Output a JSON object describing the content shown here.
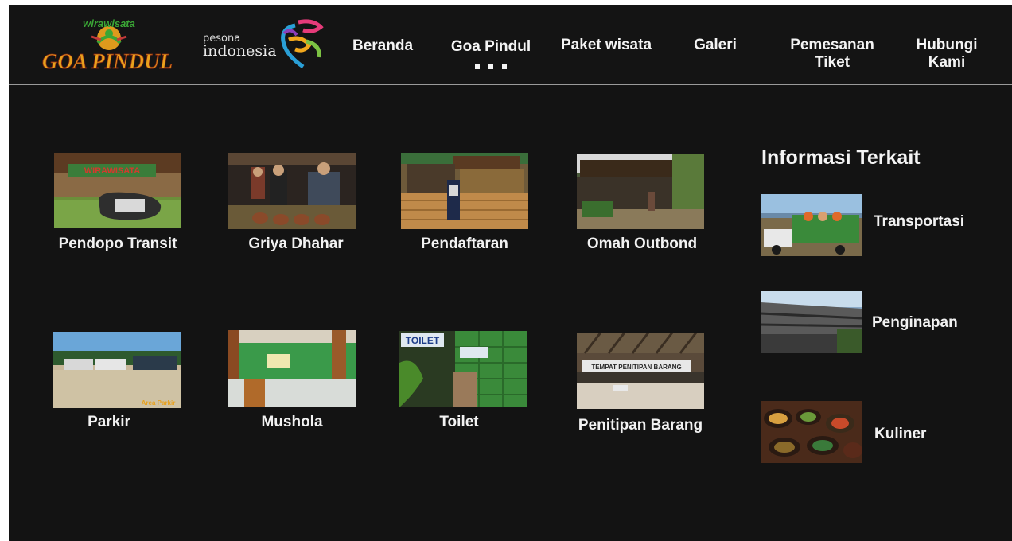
{
  "header": {
    "logo_goa_pindul": {
      "top_text": "wirawisata",
      "main_text": "GOA PINDUL"
    },
    "logo_pesona": {
      "top_text": "pesona",
      "main_text": "indonesia"
    },
    "nav": [
      {
        "label": "Beranda"
      },
      {
        "label": "Goa Pindul"
      },
      {
        "label": "Paket wisata"
      },
      {
        "label": "Galeri"
      },
      {
        "label": "Pemesanan\nTiket"
      },
      {
        "label": "Hubungi\nKami"
      }
    ],
    "active_nav_index": 1
  },
  "facilities": [
    {
      "label": "Pendopo Transit",
      "photo_sign": "WIRAWISATA"
    },
    {
      "label": "Griya Dhahar"
    },
    {
      "label": "Pendaftaran"
    },
    {
      "label": "Omah Outbond"
    },
    {
      "label": "Parkir",
      "photo_sign": "Area Parkir"
    },
    {
      "label": "Mushola"
    },
    {
      "label": "Toilet",
      "photo_sign": "TOILET"
    },
    {
      "label": "Penitipan Barang",
      "photo_sign": "TEMPAT PENITIPAN BARANG"
    }
  ],
  "related": {
    "title": "Informasi Terkait",
    "items": [
      {
        "label": "Transportasi"
      },
      {
        "label": "Penginapan"
      },
      {
        "label": "Kuliner"
      }
    ]
  },
  "colors": {
    "background": "#131313",
    "text": "#f2f2f2",
    "logo_orange": "#e8a11d",
    "logo_green": "#3aa635"
  }
}
